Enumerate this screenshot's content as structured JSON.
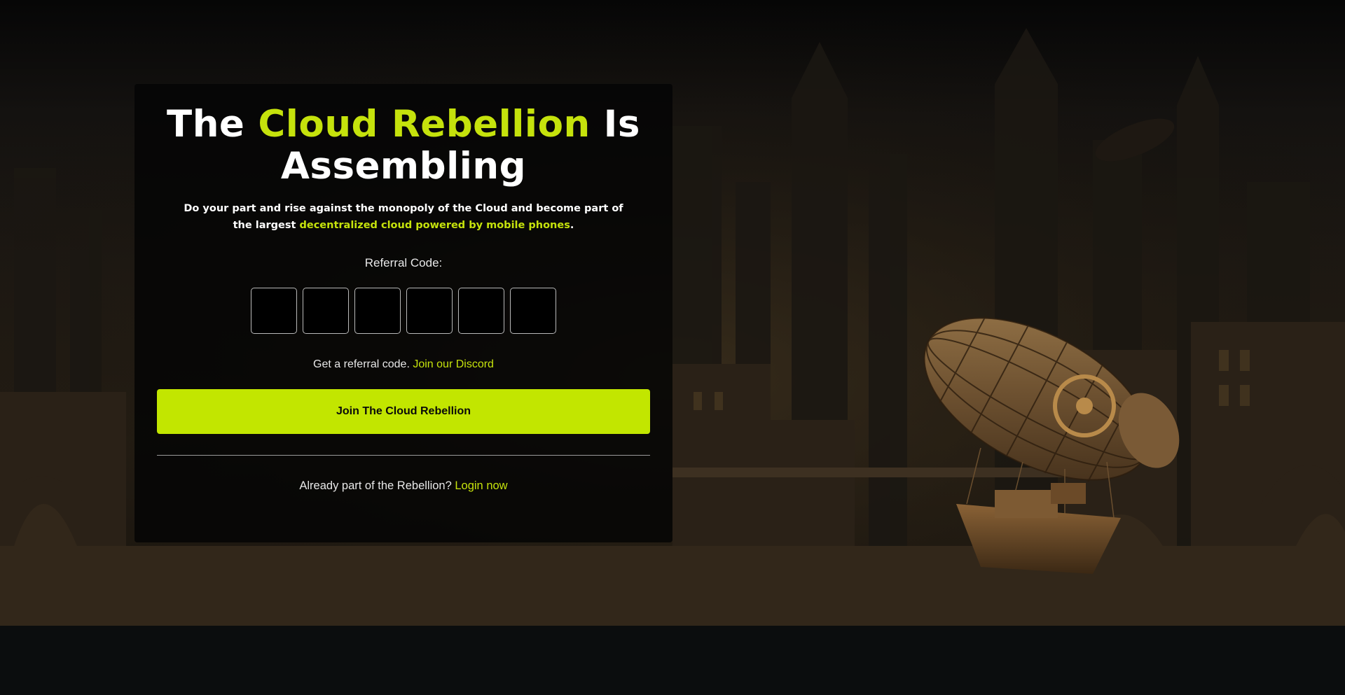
{
  "hero": {
    "title_pre": "The ",
    "title_accent": "Cloud Rebellion",
    "title_post": " Is Assembling",
    "subtitle_pre": "Do your part and rise against the monopoly of the Cloud and become part of the largest ",
    "subtitle_accent": "decentralized cloud powered by mobile phones",
    "subtitle_post": "."
  },
  "referral": {
    "label": "Referral Code:",
    "digits": [
      "",
      "",
      "",
      "",
      "",
      ""
    ],
    "help_text": "Get a referral code. ",
    "help_link": "Join our Discord"
  },
  "actions": {
    "join_label": "Join The Cloud Rebellion",
    "login_prompt": "Already part of the Rebellion? ",
    "login_link": "Login now"
  },
  "background": {
    "illustration": "steampunk-airship-over-city",
    "accent_color": "#c5e20c"
  }
}
